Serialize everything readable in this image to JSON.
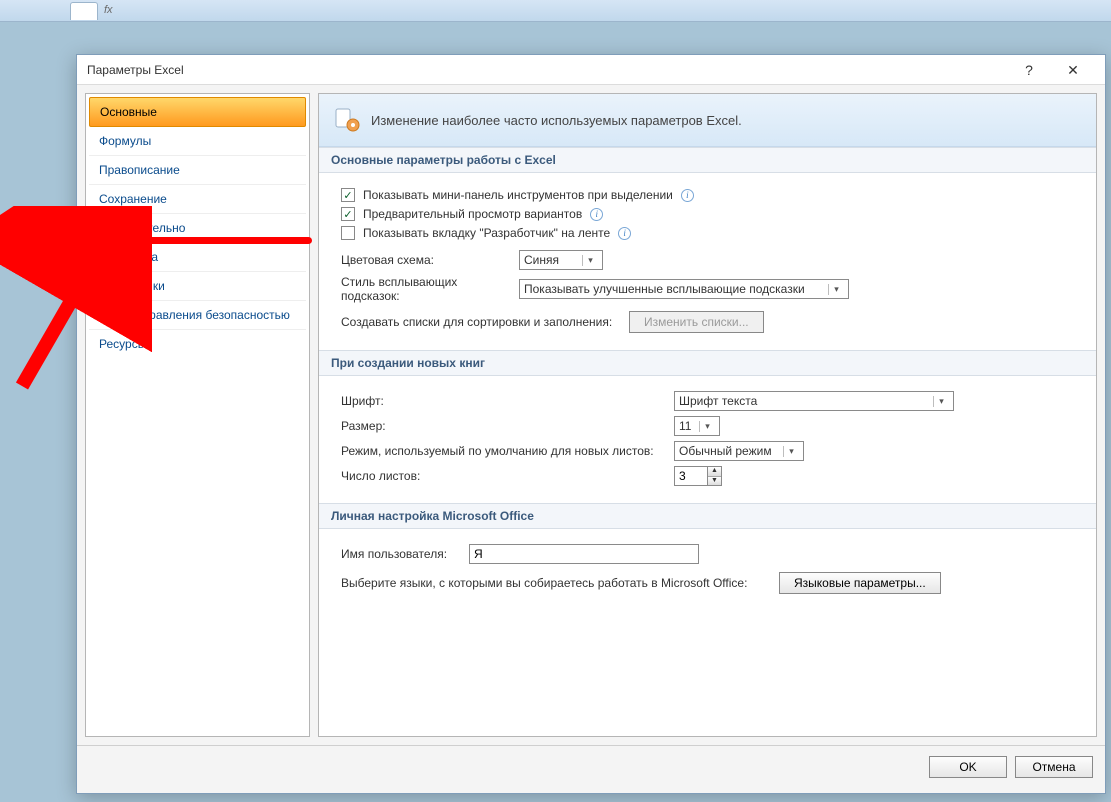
{
  "window": {
    "title": "Параметры Excel",
    "help_glyph": "?",
    "close_glyph": "✕"
  },
  "nav": {
    "items": [
      "Основные",
      "Формулы",
      "Правописание",
      "Сохранение",
      "Дополнительно",
      "Настройка",
      "Надстройки",
      "Центр управления безопасностью",
      "Ресурсы"
    ],
    "selected_index": 0,
    "highlighted_index": 4
  },
  "header": {
    "text": "Изменение наиболее часто используемых параметров Excel."
  },
  "section1": {
    "title": "Основные параметры работы с Excel",
    "chk_minipanel": {
      "label": "Показывать мини-панель инструментов при выделении",
      "checked": true
    },
    "chk_preview": {
      "label": "Предварительный просмотр вариантов",
      "checked": true
    },
    "chk_devtab": {
      "label": "Показывать вкладку \"Разработчик\" на ленте",
      "checked": false
    },
    "color_scheme_label": "Цветовая схема:",
    "color_scheme_value": "Синяя",
    "tooltip_style_label": "Стиль всплывающих подсказок:",
    "tooltip_style_value": "Показывать улучшенные всплывающие подсказки",
    "lists_label": "Создавать списки для сортировки и заполнения:",
    "lists_button": "Изменить списки..."
  },
  "section2": {
    "title": "При создании новых книг",
    "font_label": "Шрифт:",
    "font_value": "Шрифт текста",
    "size_label": "Размер:",
    "size_value": "11",
    "view_label": "Режим, используемый по умолчанию для новых листов:",
    "view_value": "Обычный режим",
    "sheets_label": "Число листов:",
    "sheets_value": "3"
  },
  "section3": {
    "title": "Личная настройка Microsoft Office",
    "username_label": "Имя пользователя:",
    "username_value": "Я",
    "lang_hint": "Выберите языки, с которыми вы собираетесь работать в Microsoft Office:",
    "lang_button": "Языковые параметры..."
  },
  "footer": {
    "ok": "OK",
    "cancel": "Отмена"
  },
  "fx_label": "fx"
}
